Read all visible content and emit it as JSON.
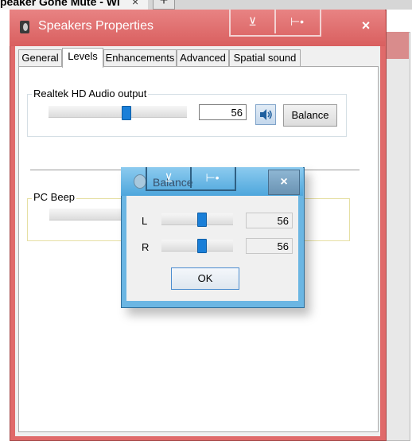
{
  "browser": {
    "tab_title": "peaker Gone Mute - Wi",
    "tab_close": "×",
    "new_tab": "+"
  },
  "main_window": {
    "title": "Speakers Properties",
    "close": "×",
    "bar_control_left": "⊻",
    "bar_control_right": "⊢•",
    "tabs": [
      {
        "label": "General"
      },
      {
        "label": "Levels"
      },
      {
        "label": "Enhancements"
      },
      {
        "label": "Advanced"
      },
      {
        "label": "Spatial sound"
      }
    ],
    "active_tab": "Levels",
    "devices": [
      {
        "label": "Realtek HD Audio output",
        "value": "56",
        "level": 0.56,
        "balance_label": "Balance"
      },
      {
        "label": "PC Beep"
      }
    ]
  },
  "balance_dialog": {
    "title": "Balance",
    "close": "×",
    "bar_control_left": "⊻",
    "bar_control_right": "⊢•",
    "channels": [
      {
        "label": "L",
        "value": "56",
        "level": 0.56
      },
      {
        "label": "R",
        "value": "56",
        "level": 0.56
      }
    ],
    "ok_label": "OK"
  },
  "icons": {
    "speaker": "speaker-icon"
  }
}
